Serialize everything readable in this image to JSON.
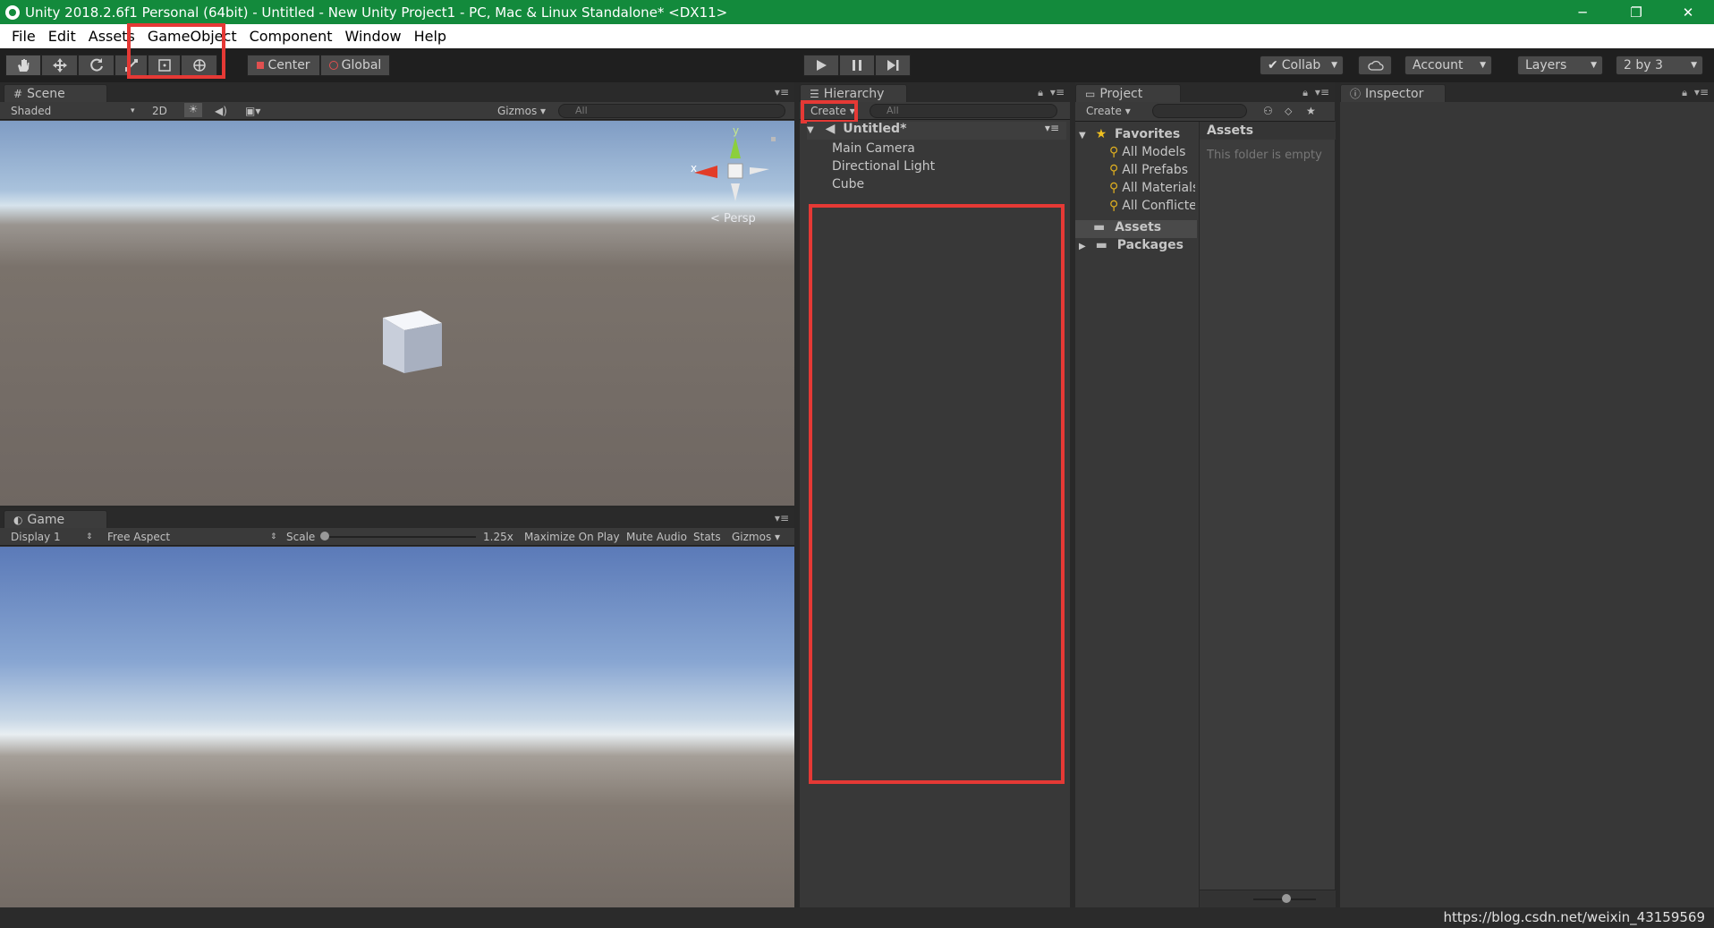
{
  "window": {
    "title": "Unity 2018.2.6f1 Personal (64bit) - Untitled - New Unity Project1 - PC, Mac & Linux Standalone* <DX11>",
    "controls": {
      "minimize": "─",
      "restore": "❐",
      "close": "✕"
    }
  },
  "menu": [
    "File",
    "Edit",
    "Assets",
    "GameObject",
    "Component",
    "Window",
    "Help"
  ],
  "toolbar": {
    "tools": [
      "hand-tool",
      "move-tool",
      "rotate-tool",
      "scale-tool",
      "rect-tool",
      "transform-tool"
    ],
    "pivot": "Center",
    "space": "Global",
    "collab": "Collab",
    "account": "Account",
    "layers": "Layers",
    "layout": "2 by 3"
  },
  "scene": {
    "tab": "Scene",
    "shading": "Shaded",
    "mode2d": "2D",
    "gizmos": "Gizmos",
    "search_placeholder": "All",
    "persp": "< Persp",
    "axis_y": "y",
    "axis_x": "x"
  },
  "game": {
    "tab": "Game",
    "display": "Display 1",
    "aspect": "Free Aspect",
    "scale_label": "Scale",
    "scale_value": "1.25x",
    "maximize": "Maximize On Play",
    "mute": "Mute Audio",
    "stats": "Stats",
    "gizmos": "Gizmos"
  },
  "hierarchy": {
    "tab": "Hierarchy",
    "create": "Create",
    "search_placeholder": "All",
    "scene_name": "Untitled*",
    "items": [
      "Main Camera",
      "Directional Light",
      "Cube"
    ]
  },
  "project": {
    "tab": "Project",
    "create": "Create",
    "favorites": "Favorites",
    "favorite_items": [
      "All Models",
      "All Prefabs",
      "All Materials",
      "All Conflicte"
    ],
    "folders": [
      "Assets",
      "Packages"
    ],
    "content_header": "Assets",
    "empty_message": "This folder is empty"
  },
  "inspector": {
    "tab": "Inspector"
  },
  "footer": {
    "watermark": "https://blog.csdn.net/weixin_43159569"
  },
  "colors": {
    "title_bar": "#138a3c",
    "highlight": "#e53935",
    "panel": "#383838"
  }
}
